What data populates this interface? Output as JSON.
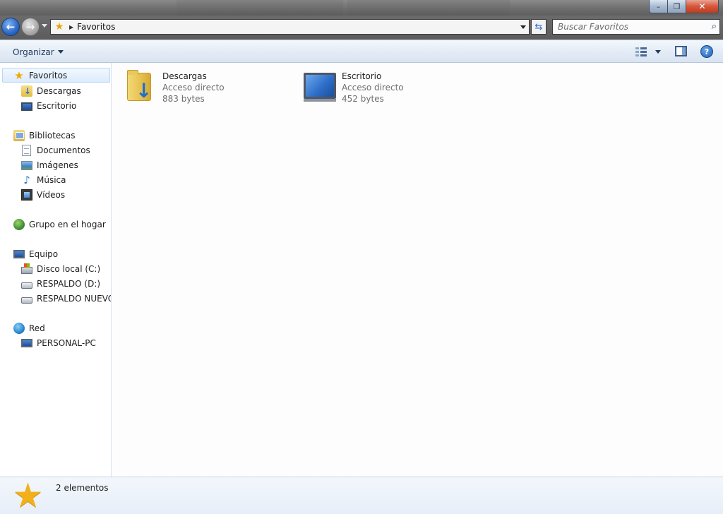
{
  "window": {
    "minimize_glyph": "–",
    "maximize_glyph": "❐",
    "close_glyph": "✕"
  },
  "navigation": {
    "address_icon": "favorites-star-icon",
    "breadcrumb": "Favoritos",
    "search_placeholder": "Buscar Favoritos"
  },
  "commandbar": {
    "organize_label": "Organizar",
    "help_glyph": "?"
  },
  "sidebar": {
    "favorites": {
      "label": "Favoritos",
      "items": [
        {
          "label": "Descargas",
          "icon": "downloads-folder-icon"
        },
        {
          "label": "Escritorio",
          "icon": "desktop-icon"
        }
      ]
    },
    "libraries": {
      "label": "Bibliotecas",
      "items": [
        {
          "label": "Documentos",
          "icon": "documents-icon"
        },
        {
          "label": "Imágenes",
          "icon": "pictures-icon"
        },
        {
          "label": "Música",
          "icon": "music-icon"
        },
        {
          "label": "Vídeos",
          "icon": "videos-icon"
        }
      ]
    },
    "homegroup": {
      "label": "Grupo en el hogar",
      "icon": "homegroup-icon"
    },
    "computer": {
      "label": "Equipo",
      "items": [
        {
          "label": "Disco local (C:)",
          "icon": "local-disk-icon"
        },
        {
          "label": "RESPALDO (D:)",
          "icon": "drive-icon"
        },
        {
          "label": "RESPALDO NUEVO (",
          "icon": "drive-icon"
        }
      ]
    },
    "network": {
      "label": "Red",
      "items": [
        {
          "label": "PERSONAL-PC",
          "icon": "computer-icon"
        }
      ]
    }
  },
  "content": {
    "items": [
      {
        "name": "Descargas",
        "type": "Acceso directo",
        "size": "883 bytes",
        "icon": "downloads-folder-icon"
      },
      {
        "name": "Escritorio",
        "type": "Acceso directo",
        "size": "452 bytes",
        "icon": "desktop-icon"
      }
    ]
  },
  "details": {
    "icon": "favorites-star-icon",
    "count_text": "2 elementos"
  },
  "colors": {
    "accent": "#2b68c6",
    "star": "#f0a800",
    "selection_bg": "#dcebfc",
    "selection_border": "#b8d6fb"
  }
}
